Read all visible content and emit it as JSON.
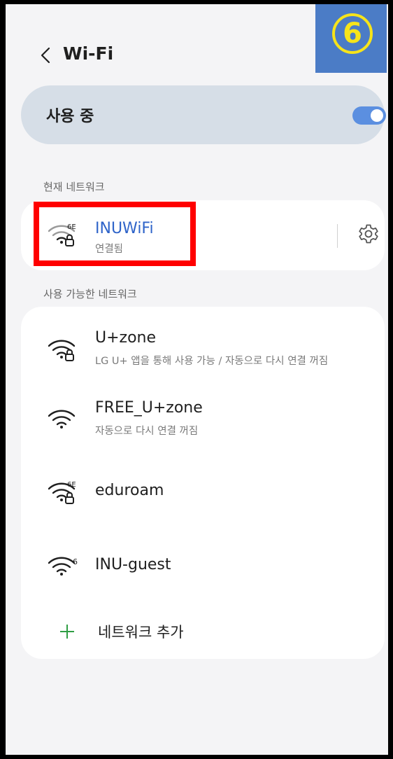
{
  "header": {
    "title": "Wi-Fi",
    "step_badge": "6"
  },
  "master": {
    "label": "사용 중",
    "enabled": true
  },
  "current_section": {
    "label": "현재 네트워크",
    "network": {
      "name": "INUWiFi",
      "status": "연결됨",
      "badge": "6E",
      "secured": true
    }
  },
  "available_section": {
    "label": "사용 가능한 네트워크",
    "networks": [
      {
        "name": "U+zone",
        "sub": "LG U+ 앱을 통해 사용 가능 / 자동으로 다시 연결 꺼짐",
        "badge": "",
        "secured": true
      },
      {
        "name": "FREE_U+zone",
        "sub": "자동으로 다시 연결 꺼짐",
        "badge": "",
        "secured": false
      },
      {
        "name": "eduroam",
        "sub": "",
        "badge": "6E",
        "secured": true
      },
      {
        "name": "INU-guest",
        "sub": "",
        "badge": "6",
        "secured": false
      }
    ],
    "add_label": "네트워크 추가"
  },
  "colors": {
    "accent": "#2f64c9",
    "toggle": "#5b8fe0",
    "highlight": "#ff0000",
    "badge_bg": "#4b7cc6",
    "badge_fg": "#f6e41a"
  }
}
